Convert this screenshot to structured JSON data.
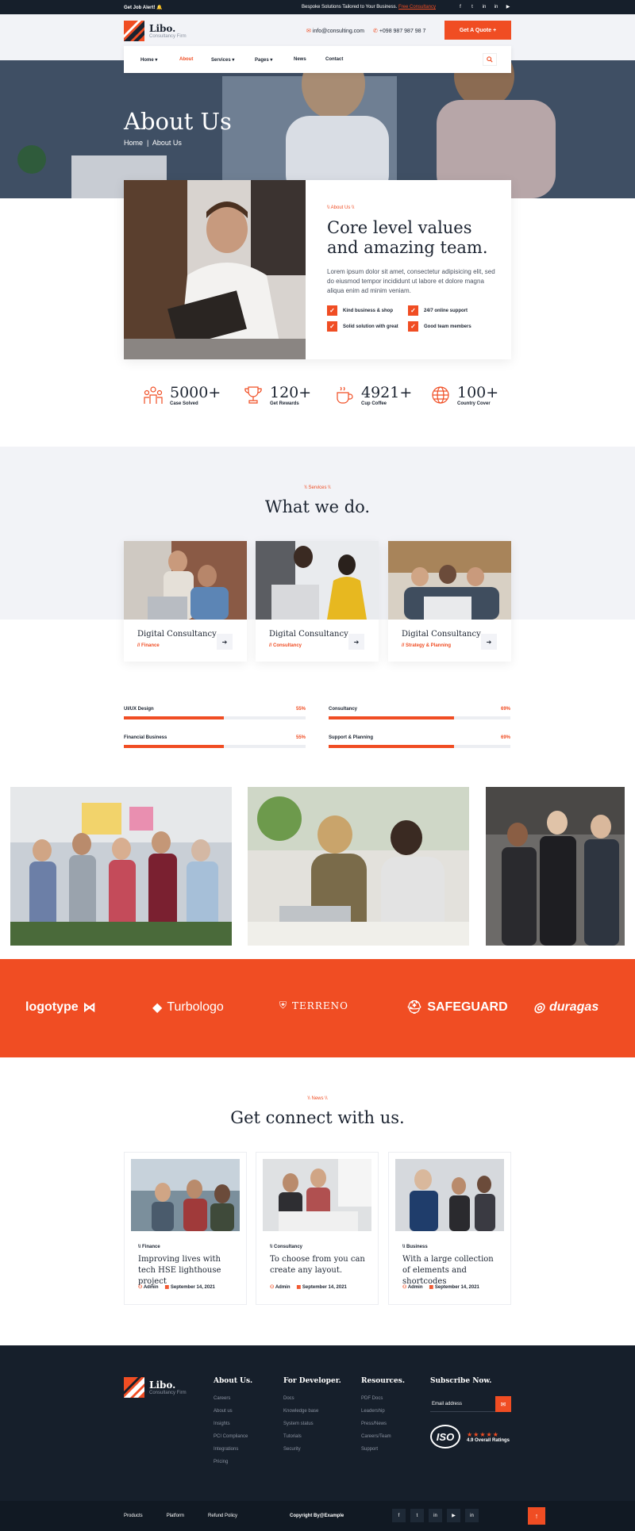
{
  "topbar": {
    "alert": "Get Job Alert!",
    "tagline": "Bespoke Solutions Tailored to Your Business.",
    "tagline_link": "Free Consultancy",
    "socials": [
      "f",
      "t",
      "in",
      "in",
      "▶"
    ]
  },
  "brand": {
    "name": "Libo.",
    "sub": "Consultancy Firm"
  },
  "header": {
    "email": "info@consulting.com",
    "phone": "+098 987 987 98 7",
    "quote": "Get A Quote +"
  },
  "nav": {
    "items": [
      "Home ▾",
      "About",
      "Services ▾",
      "Pages ▾",
      "News",
      "Contact"
    ]
  },
  "hero": {
    "title": "About Us",
    "crumb_home": "Home",
    "crumb_current": "About Us"
  },
  "about": {
    "tag": "\\\\ About Us \\\\",
    "title": "Core level values and amazing team.",
    "text": "Lorem ipsum dolor sit amet, consectetur adipisicing elit, sed do eiusmod tempor incididunt ut labore et dolore magna aliqua enim ad minim veniam.",
    "checks": [
      "Kind business & shop",
      "24/7 online support",
      "Solid solution with great",
      "Good team members"
    ]
  },
  "stats": [
    {
      "num": "5000+",
      "label": "Case Solved"
    },
    {
      "num": "120+",
      "label": "Get Rewards"
    },
    {
      "num": "4921+",
      "label": "Cup Coffee"
    },
    {
      "num": "100+",
      "label": "Country Cover"
    }
  ],
  "services": {
    "tag": "\\\\ Services \\\\",
    "title": "What we do.",
    "cards": [
      {
        "title": "Digital Consultancy",
        "cat": "// Finance"
      },
      {
        "title": "Digital Consultancy",
        "cat": "// Consultancy"
      },
      {
        "title": "Digital Consultancy",
        "cat": "// Strategy & Planning"
      }
    ]
  },
  "skills": [
    {
      "label": "UI/UX Design",
      "pct": "55%",
      "value": 55
    },
    {
      "label": "Consultancy",
      "pct": "69%",
      "value": 69
    },
    {
      "label": "Financial Business",
      "pct": "55%",
      "value": 55
    },
    {
      "label": "Support & Planning",
      "pct": "69%",
      "value": 69
    }
  ],
  "brands": [
    "logotype",
    "Turbologo",
    "TERRENO",
    "SAFEGUARD",
    "duragas"
  ],
  "news": {
    "tag": "\\\\ News \\\\",
    "title": "Get connect with us.",
    "cards": [
      {
        "cat": "\\\\ Finance",
        "title": "Improving lives with tech HSE lighthouse project",
        "author": "Admin",
        "date": "September 14, 2021"
      },
      {
        "cat": "\\\\ Consultancy",
        "title": "To choose from you can create any layout.",
        "author": "Admin",
        "date": "September 14, 2021"
      },
      {
        "cat": "\\\\ Business",
        "title": "With a large collection of elements and shortcodes",
        "author": "Admin",
        "date": "September 14, 2021"
      }
    ]
  },
  "footer": {
    "about": {
      "title": "About Us.",
      "items": [
        "Careers",
        "About us",
        "Insights",
        "PCI Compliance",
        "Integrations",
        "Pricing"
      ]
    },
    "dev": {
      "title": "For Developer.",
      "items": [
        "Docs",
        "Knowledge base",
        "System status",
        "Tutorials",
        "Security"
      ]
    },
    "res": {
      "title": "Resources.",
      "items": [
        "PDF Docs",
        "Leadership",
        "Press/News",
        "Careers/Team",
        "Support"
      ]
    },
    "subscribe": {
      "title": "Subscribe Now.",
      "placeholder": "Email address"
    },
    "rating": {
      "badge": "ISO",
      "stars": "★★★★★",
      "text": "4.9 Overall Ratings"
    }
  },
  "bottom": {
    "links": [
      "Products",
      "Platform",
      "Refund Policy"
    ],
    "copyright": "Copyright By@Example",
    "socials": [
      "f",
      "t",
      "in",
      "▶",
      "in"
    ]
  },
  "colors": {
    "accent": "#f04d23",
    "dark": "#161f2b",
    "light": "#f2f3f7"
  }
}
